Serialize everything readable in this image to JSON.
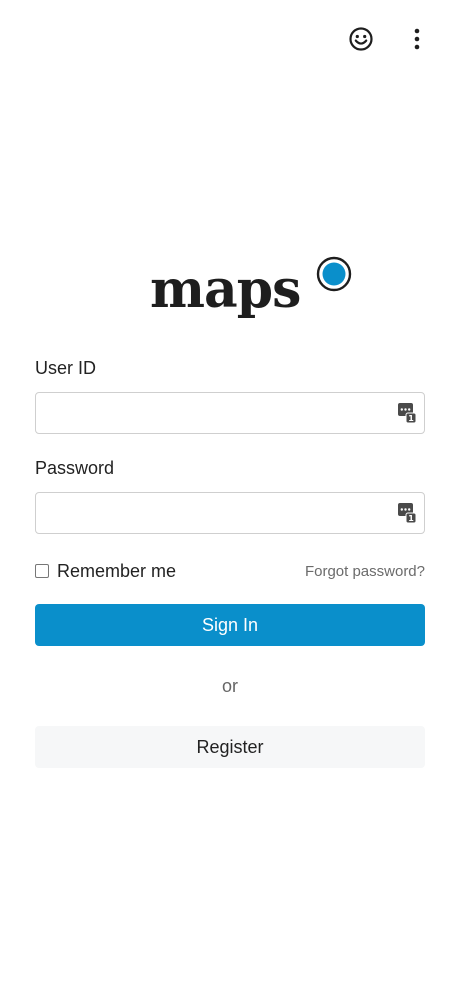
{
  "header": {
    "feedback_icon": "smiley-face-icon",
    "menu_icon": "more-vertical-icon"
  },
  "logo": {
    "text": "maps",
    "accent_color": "#0a8fcb"
  },
  "form": {
    "user_id_label": "User ID",
    "user_id_value": "",
    "password_label": "Password",
    "password_value": "",
    "remember_label": "Remember me",
    "remember_checked": false,
    "forgot_link": "Forgot password?",
    "signin_label": "Sign In",
    "or_text": "or",
    "register_label": "Register"
  },
  "colors": {
    "primary": "#0a8fcb",
    "register_bg": "#f6f7f8",
    "text": "#222222",
    "muted": "#6b6b6b"
  }
}
